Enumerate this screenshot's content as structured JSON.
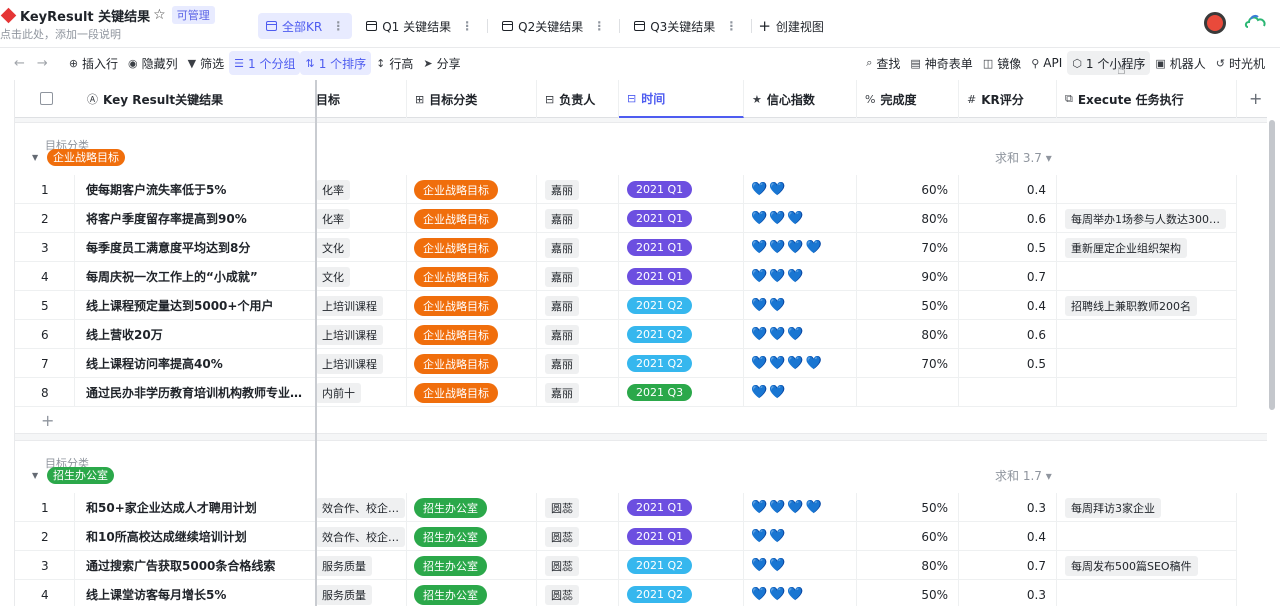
{
  "header": {
    "title": "KeyResult 关键结果",
    "star": "☆",
    "badge": "可管理",
    "description": "点击此处，添加一段说明",
    "tabs": [
      {
        "label": "全部KR",
        "active": true
      },
      {
        "label": "Q1 关键结果",
        "active": false
      },
      {
        "label": "Q2关键结果",
        "active": false
      },
      {
        "label": "Q3关键结果",
        "active": false
      }
    ],
    "create_view": "创建视图",
    "tab_menu_glyph": "⋮"
  },
  "toolbar": {
    "insert_row": "插入行",
    "hide_cols": "隐藏列",
    "filter": "筛选",
    "group": "1 个分组",
    "sort": "1 个排序",
    "row_height": "行高",
    "share": "分享",
    "find": "查找",
    "form": "神奇表单",
    "mirror": "镜像",
    "api": "API",
    "widget": "1 个小程序",
    "robot": "机器人",
    "timemachine": "时光机"
  },
  "columns": [
    {
      "label": "Key Result关键结果"
    },
    {
      "label": "目标"
    },
    {
      "label": "目标分类"
    },
    {
      "label": "负责人"
    },
    {
      "label": "时间"
    },
    {
      "label": "信心指数"
    },
    {
      "label": "完成度"
    },
    {
      "label": "KR评分"
    },
    {
      "label": "Execute 任务执行"
    }
  ],
  "groups": [
    {
      "label": "目标分类",
      "tag": "企业战略目标",
      "tag_color": "#f06e0c",
      "sum": "求和 3.7 ▾",
      "rows": [
        {
          "idx": "1",
          "name": "使每期客户流失率低于5%",
          "target": "化率",
          "category": "企业战略目标",
          "owner": "嘉丽",
          "time": "2021 Q1",
          "time_color": "#6c4fe0",
          "hearts": "💙💙",
          "pct": "60%",
          "kr": "0.4",
          "exec": ""
        },
        {
          "idx": "2",
          "name": "将客户季度留存率提高到90%",
          "target": "化率",
          "category": "企业战略目标",
          "owner": "嘉丽",
          "time": "2021 Q1",
          "time_color": "#6c4fe0",
          "hearts": "💙💙💙",
          "pct": "80%",
          "kr": "0.6",
          "exec": "每周举办1场参与人数达300…"
        },
        {
          "idx": "3",
          "name": "每季度员工满意度平均达到8分",
          "target": "文化",
          "category": "企业战略目标",
          "owner": "嘉丽",
          "time": "2021 Q1",
          "time_color": "#6c4fe0",
          "hearts": "💙💙💙💙",
          "pct": "70%",
          "kr": "0.5",
          "exec": "重新厘定企业组织架构"
        },
        {
          "idx": "4",
          "name": "每周庆祝一次工作上的“小成就”",
          "target": "文化",
          "category": "企业战略目标",
          "owner": "嘉丽",
          "time": "2021 Q1",
          "time_color": "#6c4fe0",
          "hearts": "💙💙💙",
          "pct": "90%",
          "kr": "0.7",
          "exec": ""
        },
        {
          "idx": "5",
          "name": "线上课程预定量达到5000+个用户",
          "target": "上培训课程",
          "category": "企业战略目标",
          "owner": "嘉丽",
          "time": "2021 Q2",
          "time_color": "#36b7ee",
          "hearts": "💙💙",
          "pct": "50%",
          "kr": "0.4",
          "exec": "招聘线上兼职教师200名"
        },
        {
          "idx": "6",
          "name": "线上营收20万",
          "target": "上培训课程",
          "category": "企业战略目标",
          "owner": "嘉丽",
          "time": "2021 Q2",
          "time_color": "#36b7ee",
          "hearts": "💙💙💙",
          "pct": "80%",
          "kr": "0.6",
          "exec": ""
        },
        {
          "idx": "7",
          "name": "线上课程访问率提高40%",
          "target": "上培训课程",
          "category": "企业战略目标",
          "owner": "嘉丽",
          "time": "2021 Q2",
          "time_color": "#36b7ee",
          "hearts": "💙💙💙💙",
          "pct": "70%",
          "kr": "0.5",
          "exec": ""
        },
        {
          "idx": "8",
          "name": "通过民办非学历教育培训机构教师专业…",
          "target": "内前十",
          "category": "企业战略目标",
          "owner": "嘉丽",
          "time": "2021 Q3",
          "time_color": "#2ba84a",
          "hearts": "💙💙",
          "pct": "",
          "kr": "",
          "exec": ""
        }
      ]
    },
    {
      "label": "目标分类",
      "tag": "招生办公室",
      "tag_color": "#2ba84a",
      "sum": "求和 1.7 ▾",
      "rows": [
        {
          "idx": "1",
          "name": "和50+家企业达成人才聘用计划",
          "target": "效合作、校企…",
          "category": "招生办公室",
          "owner": "圆蕊",
          "time": "2021 Q1",
          "time_color": "#6c4fe0",
          "hearts": "💙💙💙💙",
          "pct": "50%",
          "kr": "0.3",
          "exec": "每周拜访3家企业"
        },
        {
          "idx": "2",
          "name": "和10所高校达成继续培训计划",
          "target": "效合作、校企…",
          "category": "招生办公室",
          "owner": "圆蕊",
          "time": "2021 Q1",
          "time_color": "#6c4fe0",
          "hearts": "💙💙",
          "pct": "60%",
          "kr": "0.4",
          "exec": ""
        },
        {
          "idx": "3",
          "name": "通过搜索广告获取5000条合格线索",
          "target": "服务质量",
          "category": "招生办公室",
          "owner": "圆蕊",
          "time": "2021 Q2",
          "time_color": "#36b7ee",
          "hearts": "💙💙",
          "pct": "80%",
          "kr": "0.7",
          "exec": "每周发布500篇SEO稿件"
        },
        {
          "idx": "4",
          "name": "线上课堂访客每月增长5%",
          "target": "服务质量",
          "category": "招生办公室",
          "owner": "圆蕊",
          "time": "2021 Q2",
          "time_color": "#36b7ee",
          "hearts": "💙💙💙",
          "pct": "50%",
          "kr": "0.3",
          "exec": ""
        }
      ]
    }
  ]
}
